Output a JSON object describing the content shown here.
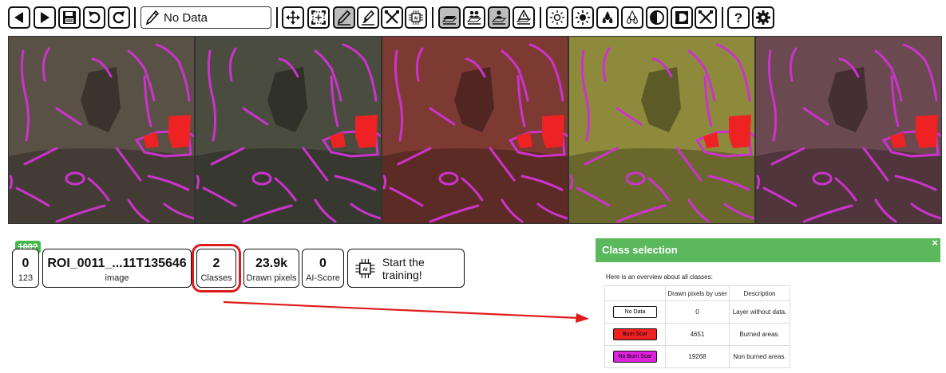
{
  "toolbar": {
    "selected_class": "No Data",
    "buttons": [
      {
        "name": "previous-button",
        "icon": "triangle-left-icon"
      },
      {
        "name": "next-button",
        "icon": "triangle-right-icon"
      },
      {
        "name": "save-button",
        "icon": "floppy-disk-icon"
      },
      {
        "name": "undo-button",
        "icon": "undo-icon"
      },
      {
        "name": "redo-button",
        "icon": "redo-icon"
      },
      {
        "name": "pan-button",
        "icon": "move-arrows-icon"
      },
      {
        "name": "fit-view-button",
        "icon": "fit-to-screen-icon"
      },
      {
        "name": "draw-button",
        "icon": "pencil-icon",
        "active": true
      },
      {
        "name": "brush-button",
        "icon": "brush-icon"
      },
      {
        "name": "erase-button",
        "icon": "cross-tools-icon"
      },
      {
        "name": "ai-button",
        "icon": "ai-chip-icon"
      },
      {
        "name": "layer-mode-1-button",
        "icon": "layers-icon",
        "active": true
      },
      {
        "name": "layer-mode-2-button",
        "icon": "layers-users-icon"
      },
      {
        "name": "layer-mode-3-button",
        "icon": "layers-user-icon",
        "active": true
      },
      {
        "name": "layer-mode-4-button",
        "icon": "layers-warning-icon"
      },
      {
        "name": "brightness-down-button",
        "icon": "sun-outline-icon"
      },
      {
        "name": "brightness-up-button",
        "icon": "sun-filled-icon"
      },
      {
        "name": "saturation-up-button",
        "icon": "drops-filled-icon"
      },
      {
        "name": "saturation-down-button",
        "icon": "drops-outline-icon"
      },
      {
        "name": "contrast-button",
        "icon": "contrast-circle-icon"
      },
      {
        "name": "invert-button",
        "icon": "contrast-square-icon"
      },
      {
        "name": "reset-adjustments-button",
        "icon": "cross-tools-icon"
      },
      {
        "name": "help-button",
        "icon": "question-mark-icon"
      },
      {
        "name": "settings-button",
        "icon": "gear-icon"
      }
    ]
  },
  "panels": [
    {
      "name": "true-color",
      "tint": "#5a5146"
    },
    {
      "name": "natural",
      "tint": "#4a4c40"
    },
    {
      "name": "false-color-red",
      "tint": "#7d3a33"
    },
    {
      "name": "false-color-green",
      "tint": "#8e8a3c"
    },
    {
      "name": "false-color-purple",
      "tint": "#6b4950"
    }
  ],
  "annotation_colors": {
    "no_burn_scar": "#cc33cc",
    "burn_scar": "#ee2222"
  },
  "stats": {
    "badge": "100?",
    "index": "0",
    "index_sub": "123",
    "image_name": "ROI_0011_...11T135646",
    "image_label": "image",
    "classes": "2",
    "classes_label": "Classes",
    "drawn_pixels": "23.9k",
    "drawn_pixels_label": "Drawn pixels",
    "ai_score": "0",
    "ai_score_label": "AI-Score",
    "train_label": "Start the training!"
  },
  "popup": {
    "title": "Class selection",
    "close": "×",
    "intro": "Here is an overview about all classes:",
    "columns": [
      "",
      "Drawn pixels by user",
      "Description"
    ],
    "rows": [
      {
        "name": "No Data",
        "pixels": "0",
        "description": "Layer without data.",
        "color": "#ffffff",
        "text_color": "#000000"
      },
      {
        "name": "Burn Scar",
        "pixels": "4651",
        "description": "Burned areas.",
        "color": "#ee2222",
        "text_color": "#000000"
      },
      {
        "name": "No Burn Scar",
        "pixels": "19268",
        "description": "Non burned areas.",
        "color": "#dd22dd",
        "text_color": "#000000"
      }
    ]
  }
}
